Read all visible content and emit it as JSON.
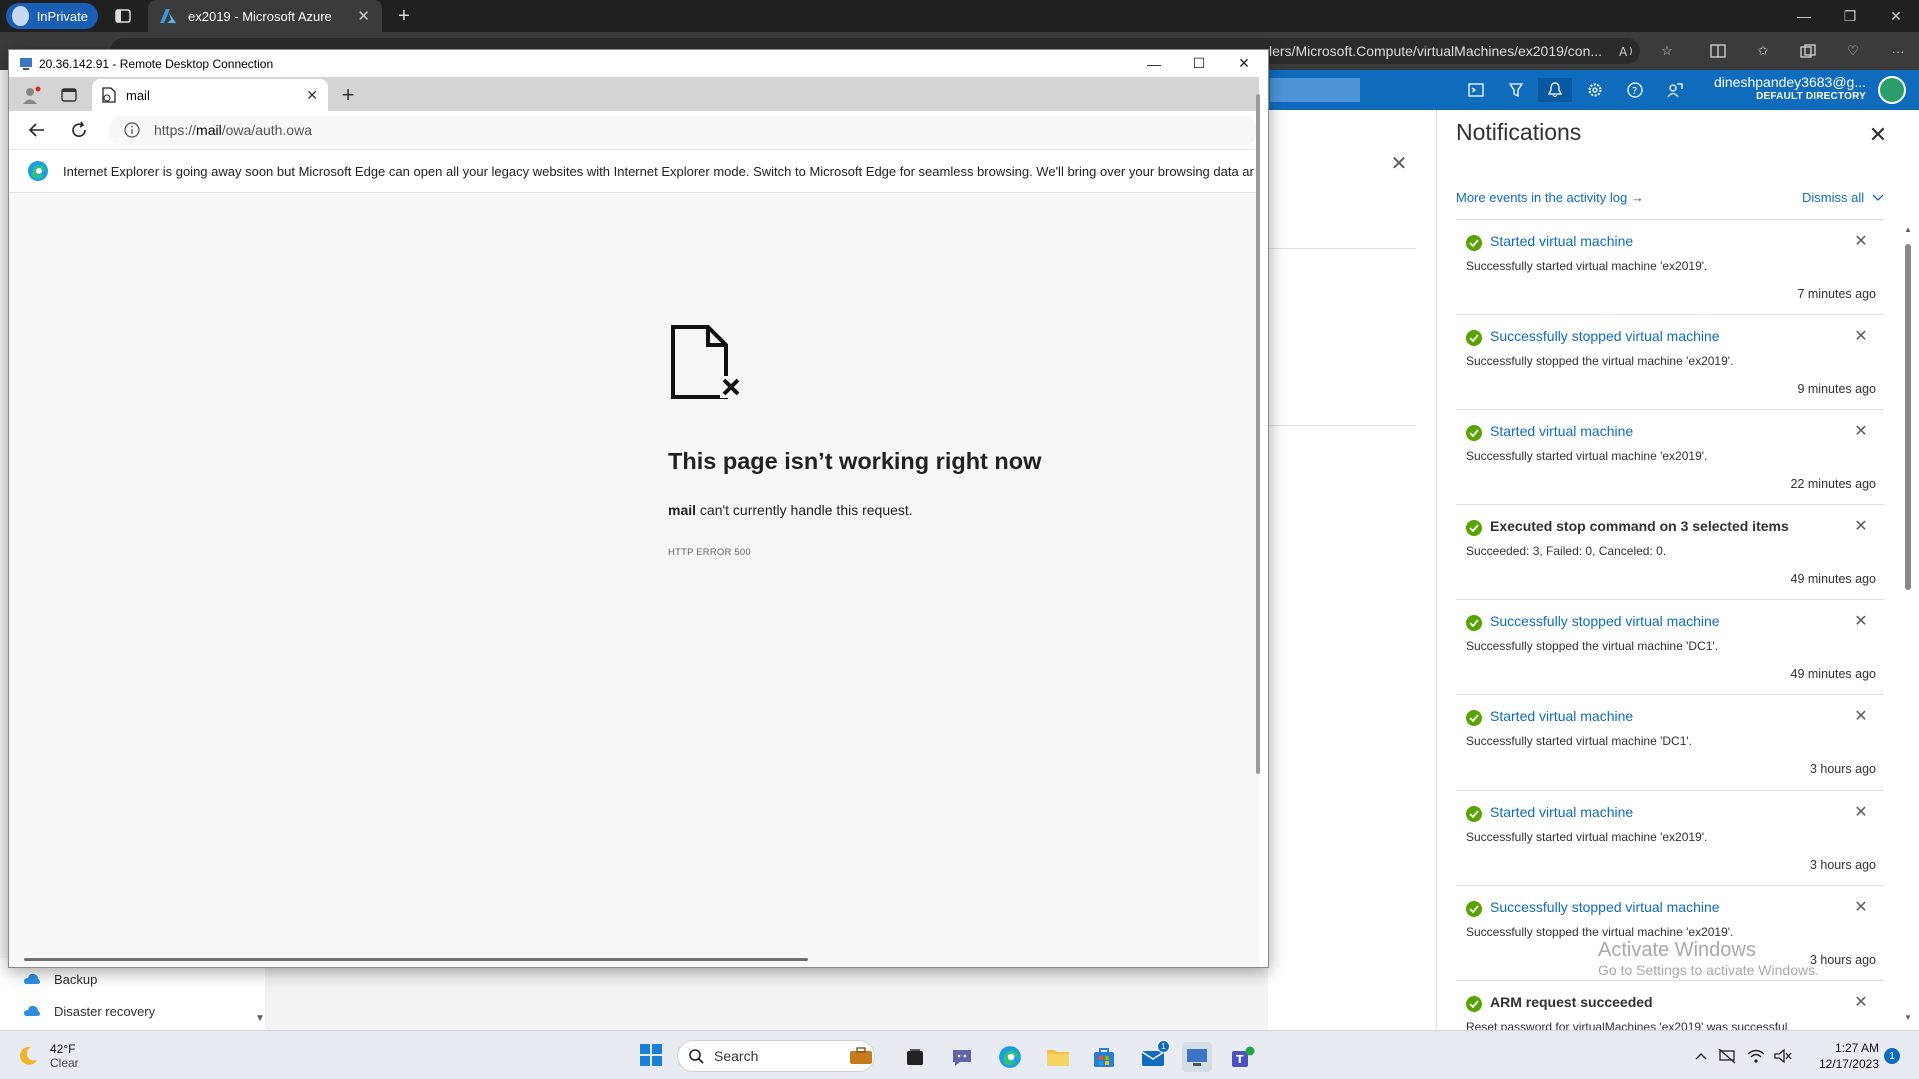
{
  "browser": {
    "inprivate_label": "InPrivate",
    "tab_title": "ex2019 - Microsoft Azure",
    "address_visible": "lers/Microsoft.Compute/virtualMachines/ex2019/con..."
  },
  "portal": {
    "user_name": "dineshpandey3683@g...",
    "user_directory": "DEFAULT DIRECTORY",
    "nav_items": [
      {
        "label": "Backup",
        "icon": "backup-icon"
      },
      {
        "label": "Disaster recovery",
        "icon": "disaster-recovery-icon"
      }
    ]
  },
  "notifications": {
    "title": "Notifications",
    "activity_link": "More events in the activity log →",
    "dismiss_all": "Dismiss all",
    "items": [
      {
        "title": "Started virtual machine",
        "message": "Successfully started virtual machine 'ex2019'.",
        "time": "7 minutes ago"
      },
      {
        "title": "Successfully stopped virtual machine",
        "message": "Successfully stopped the virtual machine 'ex2019'.",
        "time": "9 minutes ago"
      },
      {
        "title": "Started virtual machine",
        "message": "Successfully started virtual machine 'ex2019'.",
        "time": "22 minutes ago"
      },
      {
        "title": "Executed stop command on 3 selected items",
        "message": "Succeeded: 3, Failed: 0, Canceled: 0.",
        "time": "49 minutes ago"
      },
      {
        "title": "Successfully stopped virtual machine",
        "message": "Successfully stopped the virtual machine 'DC1'.",
        "time": "49 minutes ago"
      },
      {
        "title": "Started virtual machine",
        "message": "Successfully started virtual machine 'DC1'.",
        "time": "3 hours ago"
      },
      {
        "title": "Started virtual machine",
        "message": "Successfully started virtual machine 'ex2019'.",
        "time": "3 hours ago"
      },
      {
        "title": "Successfully stopped virtual machine",
        "message": "Successfully stopped the virtual machine 'ex2019'.",
        "time": "3 hours ago"
      },
      {
        "title": "ARM request succeeded",
        "message": "Reset password for virtualMachines 'ex2019' was successful",
        "time": ""
      }
    ]
  },
  "watermark": {
    "line1": "Activate Windows",
    "line2": "Go to Settings to activate Windows."
  },
  "rdp": {
    "window_title": "20.36.142.91 - Remote Desktop Connection",
    "tab_title": "mail",
    "url_prefix": "https://",
    "url_host": "mail",
    "url_path": "/owa/auth.owa",
    "ie_banner": "Internet Explorer is going away soon but Microsoft Edge can open all your legacy websites with Internet Explorer mode. Switch to Microsoft Edge for seamless browsing. We'll bring over your browsing data ar",
    "error_title": "This page isn’t working right now",
    "error_host": "mail",
    "error_message": " can't currently handle this request.",
    "error_code": "HTTP ERROR 500"
  },
  "taskbar": {
    "temperature": "42°F",
    "condition": "Clear",
    "search_placeholder": "Search",
    "time": "1:27 AM",
    "date": "12/17/2023",
    "notification_count": "1",
    "mail_badge": "1"
  },
  "colors": {
    "azure_blue": "#0f6cbd",
    "success_green": "#57a300",
    "inprivate_blue": "#1a5fb4"
  }
}
